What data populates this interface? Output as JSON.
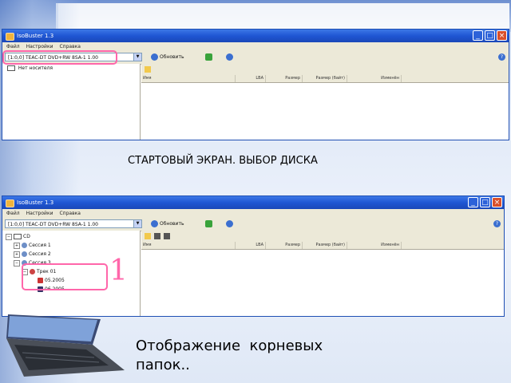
{
  "slide": {
    "caption_top": "СТАРТОВЫЙ ЭКРАН. ВЫБОР ДИСКА",
    "caption_bottom_1": "Отображение  корневых",
    "caption_bottom_2": "папок..",
    "annotation_number": "1"
  },
  "window_top": {
    "title": "IsoBuster 1.3",
    "menu": [
      "Файл",
      "Настройки",
      "Справка"
    ],
    "drive": "[1:0,0] TEAC-DT DVD+RW 8SA-1 1.00",
    "refresh_label": "Обновить",
    "tree": [
      "Нет носителя"
    ],
    "columns": [
      "Имя",
      "LBA",
      "Размер",
      "Размер (байт)",
      "Изменён"
    ]
  },
  "window_bottom": {
    "title": "IsoBuster 1.3",
    "menu": [
      "Файл",
      "Настройки",
      "Справка"
    ],
    "drive": "[1:0,0] TEAC-DT DVD+RW 8SA-1 1.00",
    "refresh_label": "Обновить",
    "tree": [
      {
        "label": "CD",
        "level": 0
      },
      {
        "label": "Сессия 1",
        "level": 1
      },
      {
        "label": "Сессия 2",
        "level": 1
      },
      {
        "label": "Сессия 3",
        "level": 1
      },
      {
        "label": "Трек 01",
        "level": 2
      },
      {
        "label": "05.2005",
        "level": 3
      },
      {
        "label": "06.2005",
        "level": 3
      }
    ],
    "columns": [
      "Имя",
      "LBA",
      "Размер",
      "Размер (байт)",
      "Изменён"
    ]
  },
  "colors": {
    "title_bar": "#1f56d3",
    "annotation": "#ff66aa",
    "close_button": "#d9502b"
  }
}
